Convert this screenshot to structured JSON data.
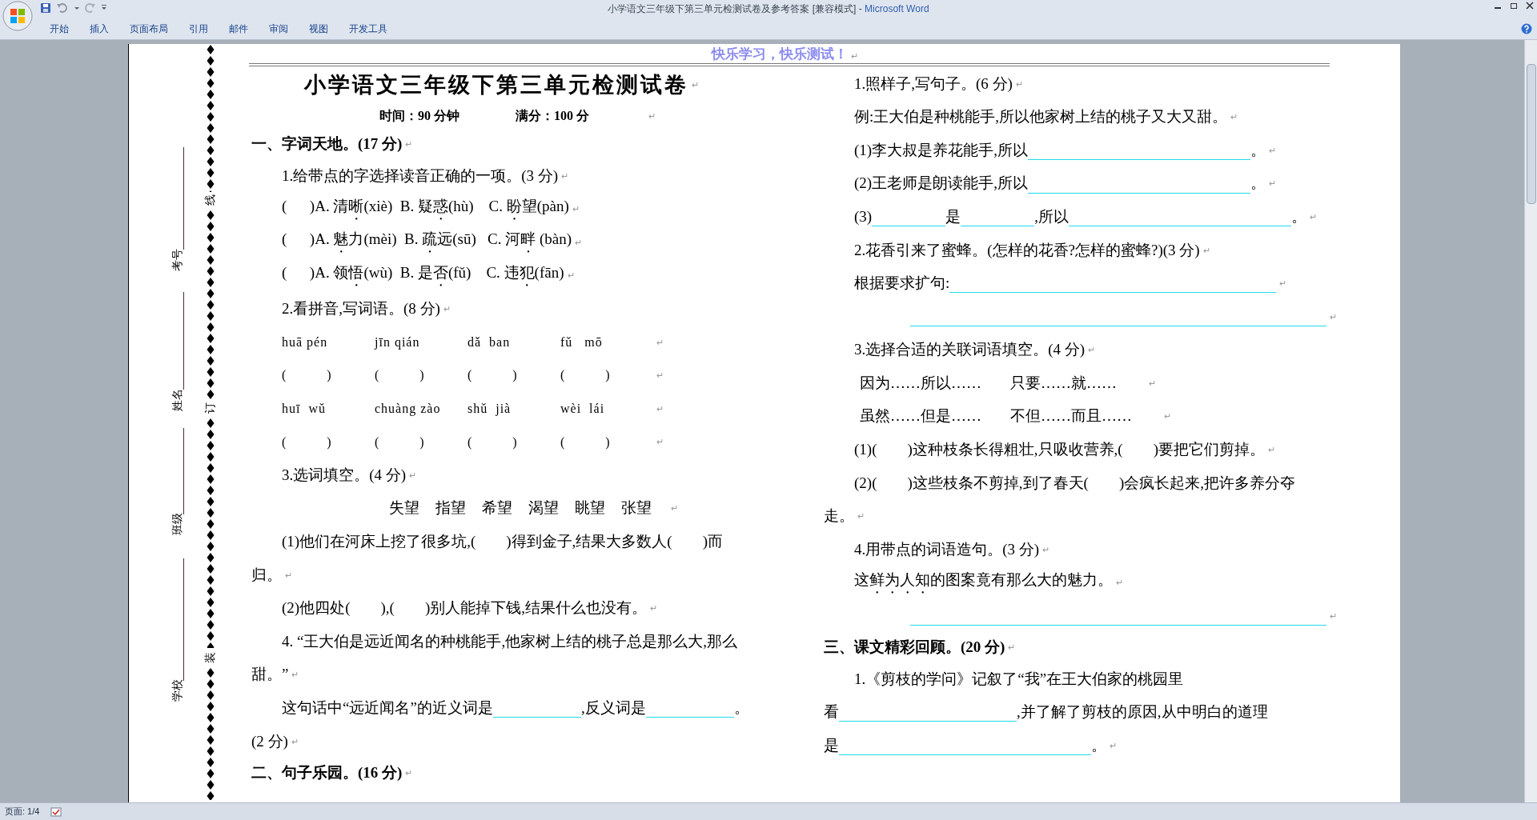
{
  "window": {
    "title": "小学语文三年级下第三单元检测试卷及参考答案 [兼容模式]",
    "separator": "-",
    "app": "Microsoft Word"
  },
  "ribbon_tabs": [
    {
      "label": "开始",
      "selected": false
    },
    {
      "label": "插入",
      "selected": false
    },
    {
      "label": "页面布局",
      "selected": false
    },
    {
      "label": "引用",
      "selected": false
    },
    {
      "label": "邮件",
      "selected": false
    },
    {
      "label": "审阅",
      "selected": false
    },
    {
      "label": "视图",
      "selected": false
    },
    {
      "label": "开发工具",
      "selected": false
    }
  ],
  "page_header": {
    "text": "快乐学习，快乐测试！",
    "end": "↵"
  },
  "binding_margin": {
    "fields": [
      "考号",
      "姓名",
      "班级",
      "学校"
    ],
    "marks": [
      "线",
      "订",
      "装"
    ]
  },
  "left_column": [
    {
      "kind": "title",
      "text": "小学语文三年级下第三单元检测试卷",
      "end": "↵"
    },
    {
      "kind": "subtitle",
      "items": [
        "时间：90 分钟",
        "满分：100 分"
      ],
      "end": "↵"
    },
    {
      "kind": "heading",
      "text": "一、字词天地。(17 分)",
      "end": "↵"
    },
    {
      "kind": "text",
      "text": "1.给带点的字选择读音正确的一项。(3 分)",
      "end": "↵"
    },
    {
      "kind": "text",
      "runs": [
        {
          "t": "(      )A. 清"
        },
        {
          "dot": "晰"
        },
        {
          "t": "(xiè)  B. 疑"
        },
        {
          "dot": "惑"
        },
        {
          "t": "(hù)    C. "
        },
        {
          "dot": "盼"
        },
        {
          "t": "望(pàn)"
        }
      ],
      "end": "↵"
    },
    {
      "kind": "text",
      "runs": [
        {
          "t": "(      )A. "
        },
        {
          "dot": "魅"
        },
        {
          "t": "力(mèi)  B. "
        },
        {
          "dot": "疏"
        },
        {
          "t": "远(sū)   C. 河"
        },
        {
          "dot": "畔"
        },
        {
          "t": " (bàn)"
        }
      ],
      "end": "↵"
    },
    {
      "kind": "text",
      "runs": [
        {
          "t": "(      )A. 领"
        },
        {
          "dot": "悟"
        },
        {
          "t": "(wù)  B. 是"
        },
        {
          "dot": "否"
        },
        {
          "t": "(fǔ)    C. 违"
        },
        {
          "dot": "犯"
        },
        {
          "t": "(fān)"
        }
      ],
      "end": "↵"
    },
    {
      "kind": "text",
      "text": "2.看拼音,写词语。(8 分)",
      "end": "↵"
    },
    {
      "kind": "grid",
      "items": [
        "huā pén",
        "jīn qián",
        "dǎ  ban",
        "fǔ   mō"
      ],
      "end": "↵"
    },
    {
      "kind": "grid",
      "items": [
        "(          )",
        "(          )",
        "(          )",
        "(          )"
      ],
      "end": "↵"
    },
    {
      "kind": "grid",
      "items": [
        "huī  wǔ",
        "chuàng zào",
        "shǔ  jià",
        "wèi  lái"
      ],
      "end": "↵"
    },
    {
      "kind": "grid",
      "items": [
        "(          )",
        "(          )",
        "(          )",
        "(          )"
      ],
      "end": "↵"
    },
    {
      "kind": "text",
      "text": "3.选词填空。(4 分)",
      "end": "↵"
    },
    {
      "kind": "words",
      "items": [
        "失望",
        "指望",
        "希望",
        "渴望",
        "眺望",
        "张望"
      ],
      "end": "↵"
    },
    {
      "kind": "text",
      "text": "(1)他们在河床上挖了很多坑,(        )得到金子,结果大多数人(        )而"
    },
    {
      "kind": "cont",
      "text": "归。",
      "end": "↵"
    },
    {
      "kind": "text",
      "text": "(2)他四处(        ),(        )别人能掉下钱,结果什么也没有。",
      "end": "↵"
    },
    {
      "kind": "text",
      "text": "4. “王大伯是远近闻名的种桃能手,他家树上结的桃子总是那么大,那么"
    },
    {
      "kind": "cont",
      "text": "甜。”",
      "end": "↵"
    },
    {
      "kind": "text",
      "runs": [
        {
          "t": "这句话中“远近闻名”的近义词是"
        },
        {
          "kind": "small"
        },
        {
          "t": ",反义词是"
        },
        {
          "kind": "small"
        },
        {
          "t": "。"
        }
      ]
    },
    {
      "kind": "cont",
      "text": "(2 分)",
      "end": "↵"
    },
    {
      "kind": "heading",
      "text": "二、句子乐园。(16 分)",
      "end": "↵"
    }
  ],
  "right_column": [
    {
      "kind": "text",
      "text": "1.照样子,写句子。(6 分)",
      "end": "↵"
    },
    {
      "kind": "text",
      "text": "例:王大伯是种桃能手,所以他家树上结的桃子又大又甜。",
      "end": "↵"
    },
    {
      "kind": "text",
      "runs": [
        {
          "t": "(1)李大叔是养花能手,所以"
        },
        {
          "kind": "long"
        },
        {
          "t": "。"
        }
      ],
      "end": "↵"
    },
    {
      "kind": "text",
      "runs": [
        {
          "t": "(2)王老师是朗读能手,所以"
        },
        {
          "kind": "long"
        },
        {
          "t": "。"
        }
      ],
      "end": "↵"
    },
    {
      "kind": "text",
      "runs": [
        {
          "t": "(3)"
        },
        {
          "kind": "tiny"
        },
        {
          "t": "是"
        },
        {
          "kind": "tiny"
        },
        {
          "t": ",所以"
        },
        {
          "kind": "long"
        },
        {
          "t": "。"
        }
      ],
      "end": "↵"
    },
    {
      "kind": "text",
      "text": "2.花香引来了蜜蜂。(怎样的花香?怎样的蜜蜂?)(3 分)",
      "end": "↵"
    },
    {
      "kind": "text",
      "runs": [
        {
          "t": "根据要求扩句:"
        },
        {
          "kind": "wide"
        }
      ],
      "end": "↵"
    },
    {
      "kind": "blank_line",
      "runs": [
        {
          "kind": "full"
        }
      ],
      "end": "↵"
    },
    {
      "kind": "text",
      "text": "3.选择合适的关联词语填空。(4 分)",
      "end": "↵"
    },
    {
      "kind": "options",
      "items": [
        "因为……所以……",
        "只要……就……"
      ],
      "end": "↵"
    },
    {
      "kind": "options",
      "items": [
        "虽然……但是……",
        "不但……而且……"
      ],
      "end": "↵"
    },
    {
      "kind": "text",
      "text": "(1)(        )这种枝条长得粗壮,只吸收营养,(        )要把它们剪掉。",
      "end": "↵"
    },
    {
      "kind": "text",
      "text": "(2)(        )这些枝条不剪掉,到了春天(        )会疯长起来,把许多养分夺"
    },
    {
      "kind": "cont",
      "text": "走。",
      "end": "↵"
    },
    {
      "kind": "text",
      "text": "4.用带点的词语造句。(3 分)",
      "end": "↵"
    },
    {
      "kind": "text",
      "runs": [
        {
          "t": "这"
        },
        {
          "dot": "鲜"
        },
        {
          "dot": "为"
        },
        {
          "dot": "人"
        },
        {
          "dot": "知"
        },
        {
          "t": "的图案竟有那么大的魅力。"
        }
      ],
      "end": "↵"
    },
    {
      "kind": "blank_line",
      "runs": [
        {
          "kind": "full"
        }
      ],
      "end": "↵"
    },
    {
      "kind": "heading",
      "text": "三、课文精彩回顾。(20 分)",
      "end": "↵"
    },
    {
      "kind": "text",
      "text": "1.《剪枝的学问》记叙了“我”在王大伯家的桃园里"
    },
    {
      "kind": "cont",
      "runs": [
        {
          "t": "看"
        },
        {
          "kind": "medium"
        },
        {
          "t": ",并了解了剪枝的原因,从中明白的道理"
        }
      ]
    },
    {
      "kind": "cont",
      "runs": [
        {
          "t": "是"
        },
        {
          "kind": "longer"
        },
        {
          "t": "。"
        }
      ],
      "end": "↵"
    }
  ],
  "status_bar": {
    "page": "页面: 1/4"
  }
}
